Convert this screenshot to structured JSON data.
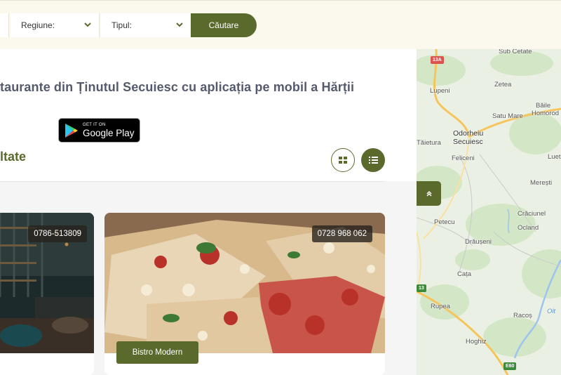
{
  "search": {
    "region_label": "Regiune:",
    "type_label": "Tipul:",
    "button_label": "Căutare"
  },
  "hero": {
    "headline": "taurante din Ținutul Secuiesc cu aplicația pe mobil a Hărții",
    "badge_small": "GET IT ON",
    "badge_big": "Google Play"
  },
  "results": {
    "title": "ltate"
  },
  "cards": [
    {
      "phone": "0786-513809"
    },
    {
      "phone": "0728 968 062",
      "tag": "Bistro Modern"
    }
  ],
  "map": {
    "places": [
      "Sub Cetate",
      "Lupeni",
      "Zetea",
      "Băile",
      "Homorod",
      "Satu Mare",
      "Odorheiu",
      "Secuiesc",
      "Tăietura",
      "Feliceni",
      "Lueta",
      "Merești",
      "Petecu",
      "Crăciunel",
      "Ocland",
      "Drăușeni",
      "Cața",
      "Rupea",
      "Racoș",
      "Olt",
      "Hoghiz"
    ],
    "roads": [
      "13A",
      "E60",
      "13"
    ],
    "colors": {
      "background": "#eaf1e4",
      "road_major": "#f6c45a",
      "river": "#9dc4ee"
    }
  },
  "colors": {
    "accent": "#5a6a2c",
    "topbar": "#fbf8ee",
    "headline": "#555b6d"
  }
}
